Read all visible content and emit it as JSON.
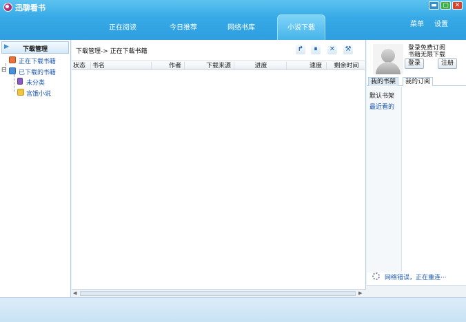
{
  "window": {
    "title": "迅聊看书",
    "controls": {
      "minimize": "▬",
      "maximize": "▢",
      "close": "✕"
    }
  },
  "tabs": [
    {
      "label": "正在阅读",
      "active": false
    },
    {
      "label": "今日推荐",
      "active": false
    },
    {
      "label": "网络书库",
      "active": false
    },
    {
      "label": "小说下载",
      "active": true
    }
  ],
  "top_links": {
    "menu": "菜单",
    "settings": "设置"
  },
  "left_panel": {
    "header": "下载管理",
    "header_arrow": "▶",
    "tree": [
      {
        "label": "正在下载书籍",
        "icon": "download-icon"
      },
      {
        "label": "已下载的书籍",
        "icon": "checked-book-icon",
        "expander": "⊟"
      },
      {
        "label": "未分类",
        "icon": "book-icon"
      },
      {
        "label": "宫饿小说",
        "icon": "folder-icon"
      }
    ]
  },
  "center_panel": {
    "breadcrumb": "下载管理-> 正在下载书籍",
    "toolbar": [
      {
        "name": "resume-icon",
        "glyph": "↱"
      },
      {
        "name": "pause-icon",
        "glyph": "⏸"
      },
      {
        "name": "delete-icon",
        "glyph": "✕"
      },
      {
        "name": "tools-icon",
        "glyph": "⚒"
      }
    ],
    "columns": [
      "状态",
      "书名",
      "作者",
      "下载来源",
      "进度",
      "速度",
      "剩余时间"
    ],
    "scroll_left": "◀",
    "scroll_right": "▶"
  },
  "right_panel": {
    "promo_line1": "登录免费订阅",
    "promo_line2": "书籍无限下载",
    "login_button": "登录",
    "register_button": "注册",
    "tabs": [
      "我的书架",
      "我的订阅"
    ],
    "shelves": [
      "默认书架",
      "最近看的"
    ],
    "network_status": "网络错误，正在重连···"
  },
  "colors": {
    "titlebar": "#36a9e6",
    "active_tab": "#46b4ea",
    "link_text": "#1b57b1"
  }
}
